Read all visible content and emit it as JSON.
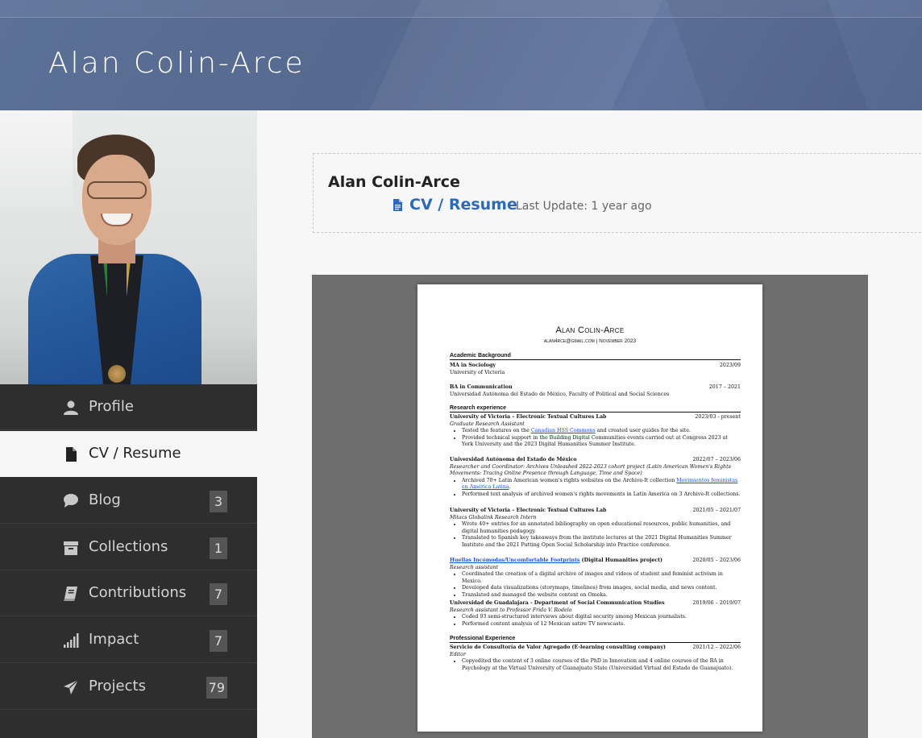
{
  "header": {
    "site_title": "Alan Colin-Arce"
  },
  "sidebar": {
    "items": [
      {
        "label": "Profile",
        "icon": "user-icon",
        "badge": ""
      },
      {
        "label": "CV / Resume",
        "icon": "document-icon",
        "badge": "",
        "active": true
      },
      {
        "label": "Blog",
        "icon": "speech-bubble-icon",
        "badge": "3"
      },
      {
        "label": "Collections",
        "icon": "archive-icon",
        "badge": "1"
      },
      {
        "label": "Contributions",
        "icon": "book-icon",
        "badge": "7"
      },
      {
        "label": "Impact",
        "icon": "signal-bars-icon",
        "badge": "7"
      },
      {
        "label": "Projects",
        "icon": "paper-plane-icon",
        "badge": "79"
      }
    ]
  },
  "main": {
    "owner_name": "Alan Colin-Arce",
    "cv_link_label": "CV / Resume",
    "last_update": "Last Update: 1 year ago"
  },
  "cv": {
    "name": "Alan Colin-Arce",
    "contact": "alan4rce@gmail.com | November 2023",
    "sections": {
      "academic": "Academic Background",
      "research": "Research experience",
      "professional": "Professional Experience"
    },
    "ma": {
      "title": "MA in Sociology",
      "date": "2023/09",
      "inst": "University of Victoria"
    },
    "ba": {
      "title": "BA in Communication",
      "date": "2017 – 2021",
      "inst": "Universidad Autónoma del Estado de México, Faculty of Political and Social Sciences"
    },
    "r1": {
      "org": "University of Victoria – Electronic Textual Cultures Lab",
      "date": "2023/03 - present",
      "role": "Graduate Research Assistant",
      "b1_pre": "Tested the features on the ",
      "b1_link": "Canadian HSS Commons",
      "b1_post": " and created user guides for the site.",
      "b2": "Provided technical support in the Building Digital Communities events carried out at Congress 2023 at York University and the 2023 Digital Humanities Summer Institute."
    },
    "r2": {
      "org": "Universidad Autónoma del Estado de México",
      "date": "2022/07 – 2023/06",
      "role": "Researcher and Coordinator: Archives Unleashed 2022-2023 cohort project (Latin American Women's Rights Movements: Tracing Online Presence through Language, Time and Space)",
      "b1_pre": "Archived 70+ Latin American women's rights websites on the Archive-It collection ",
      "b1_link": "Movimientos feministas en América Latina",
      "b1_post": ".",
      "b2": "Performed text analysis of archived women's rights movements in Latin America on 3 Archive-It collections."
    },
    "r3": {
      "org": "University of Victoria – Electronic Textual Cultures Lab",
      "date": "2021/05 – 2021/07",
      "role": "Mitacs Globalink Research Intern",
      "b1": "Wrote 40+ entries for an annotated bibliography on open educational resources, public humanities, and digital humanities pedagogy.",
      "b2": "Translated to Spanish key takeaways from the institute lectures at the 2021 Digital Humanities Summer Institute and the 2021 Putting Open Social Scholarship into Practice conference."
    },
    "r4": {
      "link": "Huellas Incómodas/Uncomfortable Footprints",
      "suffix": " (Digital Humanities project)",
      "date": "2020/05 – 2023/06",
      "role": "Research assistant",
      "b1": "Coordinated the creation of a digital archive of images and videos of student and feminist activism in Mexico.",
      "b2": "Developed data visualizations (storymaps, timelines) from images, social media, and news content.",
      "b3": "Translated and managed the website content on Omeka."
    },
    "r5": {
      "org": "Universidad de Guadalajara - Department of Social Communication Studies",
      "date": "2019/06 – 2019/07",
      "role": "Research assistant to Professor Frida V. Rodelo",
      "b1": "Coded 93 semi-structured interviews about digital security among Mexican journalists.",
      "b2": "Performed content analysis of 12 Mexican satire TV newscasts."
    },
    "p1": {
      "org": "Servicio de Consultoría de Valor Agregado (E-learning consulting company)",
      "date": "2021/12 – 2022/06",
      "role": "Editor",
      "b1": "Copyedited the content of 3 online courses of the PhD in Innovation and 4 online courses of the BA in Psychology at the Virtual University of Guanajuato State (Universidad Virtual del Estado de Guanajuato)."
    }
  },
  "colors": {
    "header_bg": "#5a6e96",
    "sidebar_bg": "#2e2e2e",
    "link": "#2a6ab8",
    "viewer_bg": "#6e6e6e"
  }
}
